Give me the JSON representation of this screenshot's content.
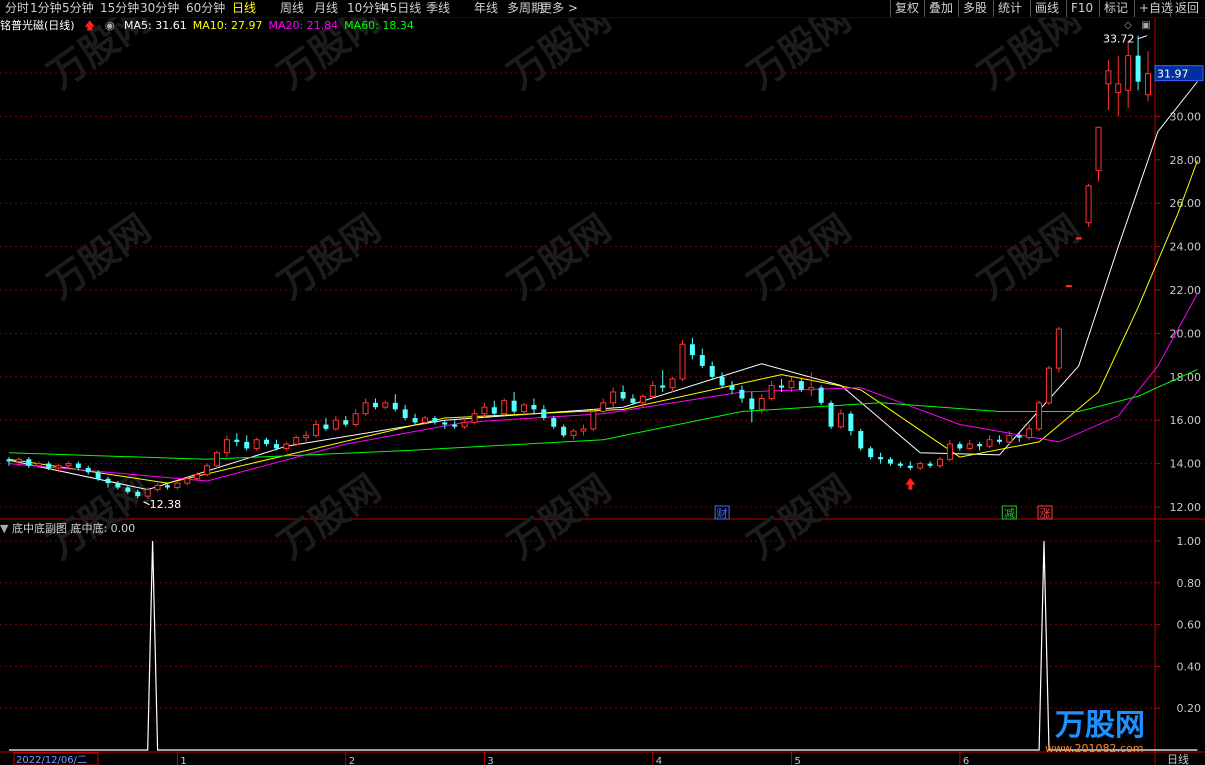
{
  "toolbar": {
    "left": [
      {
        "label": "分时",
        "active": false
      },
      {
        "label": "1分钟",
        "active": false
      },
      {
        "label": "5分钟",
        "active": false
      },
      {
        "label": "15分钟",
        "active": false
      },
      {
        "label": "30分钟",
        "active": false
      },
      {
        "label": "60分钟",
        "active": false
      },
      {
        "label": "日线",
        "active": true
      },
      {
        "label": "周线",
        "active": false
      },
      {
        "label": "月线",
        "active": false
      },
      {
        "label": "10分钟",
        "active": false
      },
      {
        "label": "45日线",
        "active": false
      },
      {
        "label": "季线",
        "active": false
      },
      {
        "label": "年线",
        "active": false
      },
      {
        "label": "多周期",
        "active": false
      },
      {
        "label": "更多 >",
        "active": false
      }
    ],
    "right": [
      "复权",
      "叠加",
      "多股",
      "统计",
      "画线",
      "F10",
      "标记",
      "+自选",
      "返回"
    ]
  },
  "stock": {
    "name": "铭普光磁(日线)",
    "ma": [
      {
        "label": "MA5: 31.61",
        "color": "#ffffff"
      },
      {
        "label": "MA10: 27.97",
        "color": "#ffff00"
      },
      {
        "label": "MA20: 21.84",
        "color": "#ff00ff"
      },
      {
        "label": "MA60: 18.34",
        "color": "#00ff00"
      }
    ]
  },
  "sub_indicator": {
    "title": "底中底副图",
    "value_text": "底中底: 0.00"
  },
  "footer": {
    "date_label": "2022/12/06/二",
    "month_ticks": [
      "1",
      "2",
      "3",
      "4",
      "5",
      "6"
    ],
    "period_label": "日线"
  },
  "markers": {
    "high_label": "33.72",
    "low_label": "12.38",
    "last_price": "31.97",
    "events": [
      "财",
      "减",
      "涨"
    ]
  },
  "watermark": {
    "text": "万股网",
    "url": "www.201082.com"
  },
  "colors": {
    "up": "#ff3232",
    "down": "#54ffff",
    "ma5": "#ffffff",
    "ma10": "#ffff00",
    "ma20": "#ff00ff",
    "ma60": "#00ff00",
    "grid": "#7a0000",
    "axis": "#c00000"
  },
  "chart_data": [
    {
      "type": "candlestick",
      "title": "铭普光磁(日线)",
      "ylim": [
        11.5,
        34.5
      ],
      "y_ticks": [
        "12.00",
        "14.00",
        "16.00",
        "18.00",
        "20.00",
        "22.00",
        "24.00",
        "26.00",
        "28.00",
        "30.00",
        "32.00"
      ],
      "x_months": [
        "1",
        "2",
        "3",
        "4",
        "5",
        "6"
      ],
      "ohlc": [
        [
          14.2,
          14.3,
          13.9,
          14.1
        ],
        [
          14.1,
          14.3,
          13.9,
          14.2
        ],
        [
          14.2,
          14.3,
          13.8,
          13.9
        ],
        [
          13.9,
          14.1,
          13.8,
          14.0
        ],
        [
          14.0,
          14.1,
          13.7,
          13.8
        ],
        [
          13.8,
          14.0,
          13.6,
          13.9
        ],
        [
          13.9,
          14.1,
          13.8,
          14.0
        ],
        [
          14.0,
          14.1,
          13.7,
          13.8
        ],
        [
          13.8,
          13.9,
          13.5,
          13.6
        ],
        [
          13.6,
          13.7,
          13.2,
          13.3
        ],
        [
          13.3,
          13.4,
          12.9,
          13.1
        ],
        [
          13.1,
          13.2,
          12.8,
          12.9
        ],
        [
          12.9,
          13.0,
          12.6,
          12.7
        ],
        [
          12.7,
          12.8,
          12.4,
          12.5
        ],
        [
          12.5,
          12.9,
          12.38,
          12.8
        ],
        [
          12.8,
          13.1,
          12.7,
          13.0
        ],
        [
          13.0,
          13.1,
          12.8,
          12.9
        ],
        [
          12.9,
          13.2,
          12.8,
          13.1
        ],
        [
          13.1,
          13.4,
          13.0,
          13.3
        ],
        [
          13.3,
          13.6,
          13.2,
          13.5
        ],
        [
          13.5,
          14.0,
          13.4,
          13.9
        ],
        [
          13.9,
          14.6,
          13.8,
          14.5
        ],
        [
          14.5,
          15.3,
          14.3,
          15.1
        ],
        [
          15.1,
          15.4,
          14.8,
          15.0
        ],
        [
          15.0,
          15.3,
          14.6,
          14.7
        ],
        [
          14.7,
          15.2,
          14.6,
          15.1
        ],
        [
          15.1,
          15.2,
          14.8,
          14.9
        ],
        [
          14.9,
          15.1,
          14.6,
          14.7
        ],
        [
          14.7,
          15.0,
          14.6,
          14.9
        ],
        [
          14.9,
          15.3,
          14.8,
          15.2
        ],
        [
          15.2,
          15.5,
          15.0,
          15.3
        ],
        [
          15.3,
          16.0,
          15.2,
          15.8
        ],
        [
          15.8,
          16.1,
          15.5,
          15.6
        ],
        [
          15.6,
          16.2,
          15.5,
          16.0
        ],
        [
          16.0,
          16.2,
          15.7,
          15.8
        ],
        [
          15.8,
          16.5,
          15.7,
          16.3
        ],
        [
          16.3,
          17.0,
          16.2,
          16.8
        ],
        [
          16.8,
          17.0,
          16.5,
          16.6
        ],
        [
          16.6,
          16.9,
          16.5,
          16.8
        ],
        [
          16.8,
          17.2,
          16.4,
          16.5
        ],
        [
          16.5,
          16.7,
          16.0,
          16.1
        ],
        [
          16.1,
          16.3,
          15.8,
          15.9
        ],
        [
          15.9,
          16.2,
          15.8,
          16.1
        ],
        [
          16.1,
          16.2,
          15.8,
          15.9
        ],
        [
          15.9,
          16.0,
          15.6,
          15.8
        ],
        [
          15.8,
          16.0,
          15.6,
          15.7
        ],
        [
          15.7,
          16.0,
          15.6,
          15.9
        ],
        [
          15.9,
          16.5,
          15.8,
          16.3
        ],
        [
          16.3,
          16.8,
          16.1,
          16.6
        ],
        [
          16.6,
          16.9,
          16.2,
          16.3
        ],
        [
          16.3,
          17.0,
          16.2,
          16.9
        ],
        [
          16.9,
          17.3,
          16.3,
          16.4
        ],
        [
          16.4,
          16.8,
          16.2,
          16.7
        ],
        [
          16.7,
          17.0,
          16.3,
          16.5
        ],
        [
          16.5,
          16.7,
          16.0,
          16.1
        ],
        [
          16.1,
          16.2,
          15.6,
          15.7
        ],
        [
          15.7,
          15.8,
          15.2,
          15.3
        ],
        [
          15.3,
          15.6,
          15.1,
          15.5
        ],
        [
          15.5,
          15.8,
          15.3,
          15.6
        ],
        [
          15.6,
          16.5,
          15.5,
          16.4
        ],
        [
          16.4,
          17.0,
          16.3,
          16.8
        ],
        [
          16.8,
          17.5,
          16.6,
          17.3
        ],
        [
          17.3,
          17.6,
          16.9,
          17.0
        ],
        [
          17.0,
          17.2,
          16.7,
          16.8
        ],
        [
          16.8,
          17.2,
          16.6,
          17.1
        ],
        [
          17.1,
          17.8,
          17.0,
          17.6
        ],
        [
          17.6,
          18.3,
          17.3,
          17.5
        ],
        [
          17.5,
          18.0,
          17.3,
          17.9
        ],
        [
          17.9,
          19.7,
          17.8,
          19.5
        ],
        [
          19.5,
          19.8,
          18.8,
          19.0
        ],
        [
          19.0,
          19.3,
          18.4,
          18.5
        ],
        [
          18.5,
          18.7,
          17.9,
          18.0
        ],
        [
          18.0,
          18.2,
          17.5,
          17.6
        ],
        [
          17.6,
          17.8,
          17.2,
          17.4
        ],
        [
          17.4,
          17.6,
          16.8,
          17.0
        ],
        [
          17.0,
          17.3,
          15.9,
          16.5
        ],
        [
          16.5,
          17.2,
          16.3,
          17.0
        ],
        [
          17.0,
          17.8,
          16.9,
          17.6
        ],
        [
          17.6,
          17.9,
          17.3,
          17.5
        ],
        [
          17.5,
          18.0,
          17.3,
          17.8
        ],
        [
          17.8,
          17.9,
          17.3,
          17.4
        ],
        [
          17.4,
          18.2,
          17.1,
          17.5
        ],
        [
          17.5,
          17.6,
          16.7,
          16.8
        ],
        [
          16.8,
          16.9,
          15.6,
          15.7
        ],
        [
          15.7,
          16.5,
          15.6,
          16.3
        ],
        [
          16.3,
          16.4,
          15.3,
          15.5
        ],
        [
          15.5,
          15.6,
          14.6,
          14.7
        ],
        [
          14.7,
          14.8,
          14.2,
          14.3
        ],
        [
          14.3,
          14.5,
          14.0,
          14.2
        ],
        [
          14.2,
          14.3,
          13.9,
          14.0
        ],
        [
          14.0,
          14.1,
          13.8,
          13.9
        ],
        [
          13.9,
          14.1,
          13.7,
          13.8
        ],
        [
          13.8,
          14.1,
          13.7,
          14.0
        ],
        [
          14.0,
          14.1,
          13.8,
          13.9
        ],
        [
          13.9,
          14.3,
          13.8,
          14.2
        ],
        [
          14.2,
          15.1,
          14.1,
          14.9
        ],
        [
          14.9,
          15.0,
          14.6,
          14.7
        ],
        [
          14.7,
          15.1,
          14.6,
          14.9
        ],
        [
          14.9,
          15.0,
          14.6,
          14.8
        ],
        [
          14.8,
          15.3,
          14.7,
          15.1
        ],
        [
          15.1,
          15.3,
          14.9,
          15.0
        ],
        [
          15.0,
          15.5,
          14.9,
          15.3
        ],
        [
          15.3,
          15.4,
          15.0,
          15.2
        ],
        [
          15.2,
          15.8,
          15.1,
          15.6
        ],
        [
          15.6,
          16.9,
          15.5,
          16.8
        ],
        [
          16.8,
          18.5,
          16.7,
          18.4
        ],
        [
          18.4,
          20.3,
          18.2,
          20.2
        ],
        [
          22.2,
          22.2,
          22.2,
          22.2
        ],
        [
          24.4,
          24.4,
          24.4,
          24.4
        ],
        [
          25.1,
          26.9,
          24.9,
          26.8
        ],
        [
          27.5,
          29.5,
          27.0,
          29.5
        ],
        [
          31.5,
          32.6,
          30.3,
          32.1
        ],
        [
          31.1,
          32.8,
          30.0,
          31.5
        ],
        [
          31.2,
          33.5,
          30.4,
          32.8
        ],
        [
          32.8,
          33.72,
          31.2,
          31.6
        ],
        [
          31.0,
          33.0,
          30.7,
          31.97
        ]
      ],
      "ma": {
        "MA5": [
          [
            0,
            14.15
          ],
          [
            14,
            12.8
          ],
          [
            28,
            14.8
          ],
          [
            44,
            16.0
          ],
          [
            62,
            16.6
          ],
          [
            76,
            18.6
          ],
          [
            84,
            17.6
          ],
          [
            92,
            14.5
          ],
          [
            100,
            14.4
          ],
          [
            108,
            18.5
          ],
          [
            112,
            24.0
          ],
          [
            116,
            29.3
          ],
          [
            120,
            31.61
          ]
        ],
        "MA10": [
          [
            0,
            14.2
          ],
          [
            16,
            13.1
          ],
          [
            30,
            14.6
          ],
          [
            44,
            16.1
          ],
          [
            62,
            16.5
          ],
          [
            78,
            18.1
          ],
          [
            86,
            17.4
          ],
          [
            96,
            14.3
          ],
          [
            104,
            15.0
          ],
          [
            110,
            17.3
          ],
          [
            114,
            21.2
          ],
          [
            118,
            25.5
          ],
          [
            120,
            27.97
          ]
        ],
        "MA20": [
          [
            0,
            14.0
          ],
          [
            20,
            13.2
          ],
          [
            34,
            14.9
          ],
          [
            46,
            15.9
          ],
          [
            60,
            16.3
          ],
          [
            74,
            17.3
          ],
          [
            86,
            17.5
          ],
          [
            96,
            15.8
          ],
          [
            106,
            15.0
          ],
          [
            112,
            16.2
          ],
          [
            116,
            18.5
          ],
          [
            120,
            21.84
          ]
        ],
        "MA60": [
          [
            0,
            14.5
          ],
          [
            20,
            14.2
          ],
          [
            40,
            14.6
          ],
          [
            60,
            15.1
          ],
          [
            74,
            16.4
          ],
          [
            88,
            16.8
          ],
          [
            100,
            16.4
          ],
          [
            108,
            16.4
          ],
          [
            114,
            17.1
          ],
          [
            120,
            18.34
          ]
        ]
      }
    },
    {
      "type": "line",
      "title": "底中底副图",
      "series": [
        {
          "name": "底中底",
          "points": [
            [
              0,
              0
            ],
            [
              14,
              0
            ],
            [
              14.5,
              1.0
            ],
            [
              15,
              0
            ],
            [
              104,
              0
            ],
            [
              104.5,
              1.0
            ],
            [
              105,
              0
            ],
            [
              120,
              0
            ]
          ]
        }
      ],
      "ylim": [
        0,
        1.05
      ],
      "y_ticks": [
        "0.20",
        "0.40",
        "0.60",
        "0.80",
        "1.00"
      ]
    }
  ]
}
